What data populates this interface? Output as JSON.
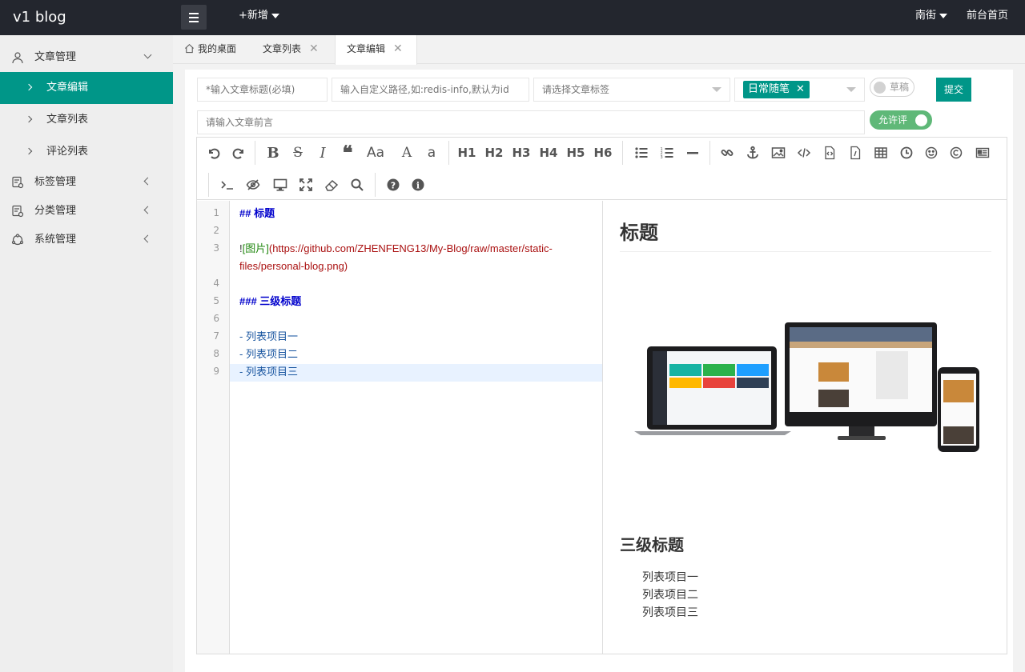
{
  "app": {
    "logo": "v1 blog",
    "new_label": "+新增",
    "user_name": "南街",
    "front_link": "前台首页"
  },
  "sidebar": {
    "groups": [
      {
        "label": "文章管理",
        "icon": "user-icon",
        "expanded": true,
        "items": [
          {
            "label": "文章编辑",
            "active": true
          },
          {
            "label": "文章列表"
          },
          {
            "label": "评论列表"
          }
        ]
      },
      {
        "label": "标签管理",
        "icon": "tag-icon"
      },
      {
        "label": "分类管理",
        "icon": "category-icon"
      },
      {
        "label": "系统管理",
        "icon": "settings-icon"
      }
    ]
  },
  "tabs": [
    {
      "label": "我的桌面",
      "icon": "home-icon",
      "closable": false
    },
    {
      "label": "文章列表",
      "closable": true
    },
    {
      "label": "文章编辑",
      "closable": true,
      "active": true
    }
  ],
  "form": {
    "title_placeholder": "*输入文章标题(必填)",
    "path_placeholder": "输入自定义路径,如:redis-info,默认为id",
    "tags_placeholder": "请选择文章标签",
    "category_selected": "日常随笔",
    "draft_label": "草稿",
    "submit_label": "提交",
    "preface_placeholder": "请输入文章前言",
    "comment_label": "允许评"
  },
  "toolbar": {
    "heading_labels": [
      "H1",
      "H2",
      "H3",
      "H4",
      "H5",
      "H6"
    ],
    "font_labels": [
      "Aa",
      "A",
      "a"
    ]
  },
  "editor": {
    "line_numbers": [
      "1",
      "2",
      "3",
      "4",
      "5",
      "6",
      "7",
      "8",
      "9"
    ],
    "lines": {
      "l1": "## 标题",
      "l3_bang": "!",
      "l3_alt": "[图片]",
      "l3_url": "(https://github.com/ZHENFENG13/My-Blog/raw/master/static-files/personal-blog.png)",
      "l5": "### 三级标题",
      "l7": "- 列表项目一",
      "l8": "- 列表项目二",
      "l9": "- 列表项目三"
    }
  },
  "preview": {
    "h2": "标题",
    "h3": "三级标题",
    "list": [
      "列表项目一",
      "列表项目二",
      "列表项目三"
    ]
  },
  "colors": {
    "accent": "#009688",
    "topbar": "#23262e",
    "switch_on": "#5fb878"
  }
}
